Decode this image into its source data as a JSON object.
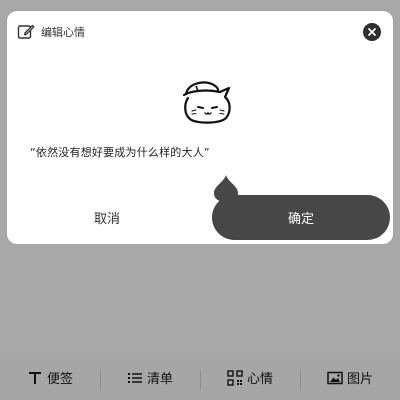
{
  "dialog": {
    "title": "编辑心情",
    "mood_text": "“依然没有想好要成为什么样的大人”",
    "cancel_label": "取消",
    "confirm_label": "确定"
  },
  "icons": {
    "edit": "edit-pencil-icon",
    "close": "close-circle-icon",
    "cat": "cat-with-cap-illustration",
    "note": "text-T-icon",
    "list": "list-icon",
    "mood": "qr-grid-icon",
    "image": "image-icon"
  },
  "toolbar": {
    "items": [
      {
        "label": "便签"
      },
      {
        "label": "清单"
      },
      {
        "label": "心情"
      },
      {
        "label": "图片"
      }
    ]
  },
  "colors": {
    "overlay": "#a8a8a8",
    "dialog_bg": "#ffffff",
    "confirm_bg": "#474747",
    "text_dark": "#222222"
  }
}
